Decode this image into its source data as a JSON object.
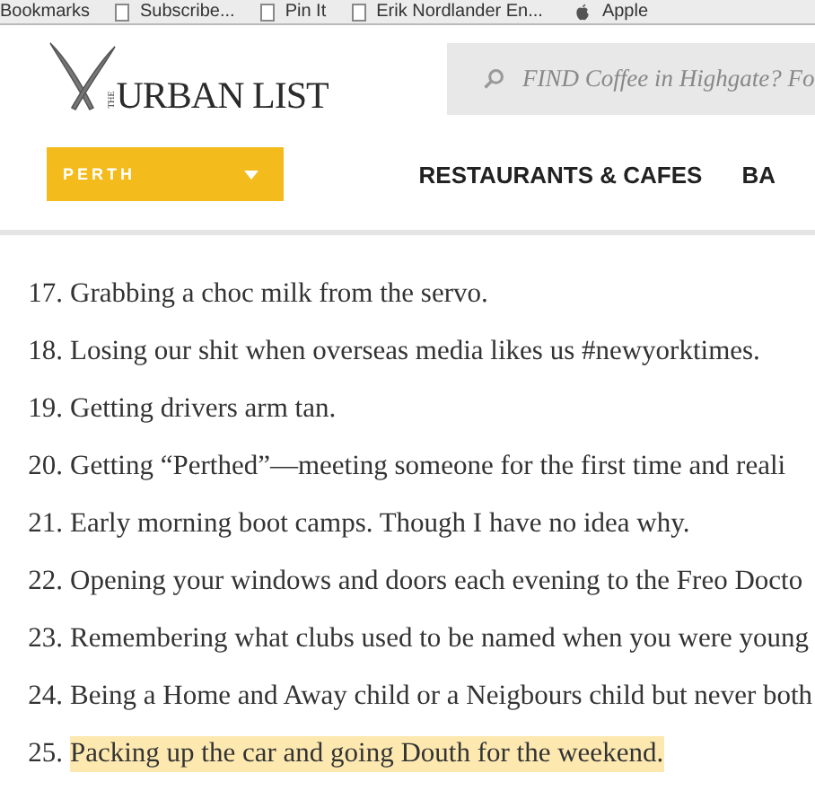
{
  "bookmarks_bar": {
    "items": [
      {
        "label": "Bookmarks",
        "kind": "text"
      },
      {
        "label": "Subscribe...",
        "kind": "page"
      },
      {
        "label": "Pin It",
        "kind": "page"
      },
      {
        "label": "Erik Nordlander En...",
        "kind": "page"
      },
      {
        "label": "Apple",
        "kind": "apple"
      }
    ]
  },
  "header": {
    "logo": {
      "small": "THE",
      "main": "URBAN LIST"
    },
    "search": {
      "placeholder": "FIND Coffee in Highgate? Fo"
    },
    "city": {
      "label": "PERTH"
    },
    "nav": [
      "RESTAURANTS & CAFES",
      "BA"
    ]
  },
  "list": [
    {
      "number": "17.",
      "text": "Grabbing a choc milk from the servo.",
      "highlighted": false
    },
    {
      "number": "18.",
      "text": "Losing our shit when overseas media likes us #newyorktimes.",
      "highlighted": false
    },
    {
      "number": "19.",
      "text": "Getting drivers arm tan.",
      "highlighted": false
    },
    {
      "number": "20.",
      "text": "Getting “Perthed”—meeting someone for the first time and reali",
      "highlighted": false
    },
    {
      "number": "21.",
      "text": "Early morning boot camps. Though I have no idea why.",
      "highlighted": false
    },
    {
      "number": "22.",
      "text": "Opening your windows and doors each evening to the Freo Docto",
      "highlighted": false
    },
    {
      "number": "23.",
      "text": "Remembering what clubs used to be named when you were young",
      "highlighted": false
    },
    {
      "number": "24.",
      "text": "Being a Home and Away child or a Neigbours child but never both",
      "highlighted": false
    },
    {
      "number": "25.",
      "text": "Packing up the car and going Douth for the weekend.",
      "highlighted": true
    }
  ]
}
